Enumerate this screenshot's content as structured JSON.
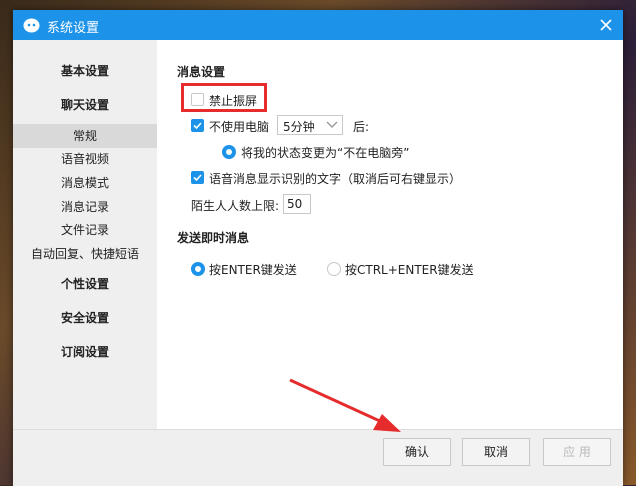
{
  "window": {
    "title": "系统设置"
  },
  "sidebar": {
    "items": [
      {
        "label": "基本设置"
      },
      {
        "label": "聊天设置"
      },
      {
        "label": "常规"
      },
      {
        "label": "语音视频"
      },
      {
        "label": "消息模式"
      },
      {
        "label": "消息记录"
      },
      {
        "label": "文件记录"
      },
      {
        "label": "自动回复、快捷短语"
      },
      {
        "label": "个性设置"
      },
      {
        "label": "安全设置"
      },
      {
        "label": "订阅设置"
      }
    ],
    "active": "常规"
  },
  "message_settings": {
    "title": "消息设置",
    "disable_shake": {
      "label": "禁止振屏",
      "checked": false
    },
    "idle": {
      "label": "不使用电脑",
      "checked": true,
      "duration": "5分钟",
      "suffix": "后:"
    },
    "status_change": {
      "label": "将我的状态变更为“不在电脑旁”",
      "selected": true
    },
    "voice_text": {
      "label": "语音消息显示识别的文字（取消后可右键显示）",
      "checked": true
    },
    "stranger_limit": {
      "label": "陌生人人数上限:",
      "value": "50"
    }
  },
  "send_settings": {
    "title": "发送即时消息",
    "options": [
      {
        "label": "按ENTER键发送",
        "selected": true
      },
      {
        "label": "按CTRL+ENTER键发送",
        "selected": false
      }
    ]
  },
  "footer": {
    "confirm": "确认",
    "cancel": "取消",
    "apply": "应 用"
  },
  "colors": {
    "accent": "#1c92e8",
    "highlight": "#e52b2b"
  }
}
